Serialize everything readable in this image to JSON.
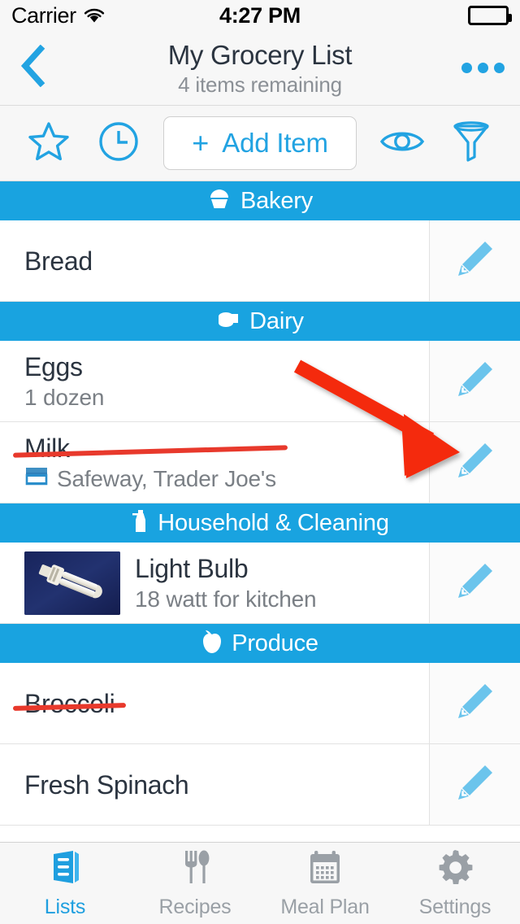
{
  "status_bar": {
    "carrier": "Carrier",
    "wifi_icon": "wifi-icon",
    "time": "4:27 PM",
    "battery_icon": "battery-full-icon"
  },
  "nav_bar": {
    "back_icon": "chevron-left-icon",
    "title": "My Grocery List",
    "subtitle": "4 items remaining",
    "more_icon": "ellipsis-icon"
  },
  "toolbar": {
    "favorite_icon": "star-outline-icon",
    "recent_icon": "clock-icon",
    "add_plus": "+",
    "add_label": "Add Item",
    "view_icon": "eye-icon",
    "filter_icon": "funnel-icon"
  },
  "sections": [
    {
      "title": "Bakery",
      "icon": "cupcake-icon",
      "items": [
        {
          "name": "Bread",
          "detail": "",
          "store": "",
          "completed": false,
          "has_image": false,
          "edit_icon": "pencil-icon"
        }
      ]
    },
    {
      "title": "Dairy",
      "icon": "cheese-icon",
      "items": [
        {
          "name": "Eggs",
          "detail": "1 dozen",
          "store": "",
          "completed": false,
          "has_image": false,
          "edit_icon": "pencil-icon"
        },
        {
          "name": "Milk",
          "detail": "",
          "store": "Safeway, Trader Joe's",
          "completed": true,
          "has_image": false,
          "edit_icon": "pencil-icon"
        }
      ]
    },
    {
      "title": "Household & Cleaning",
      "icon": "spray-bottle-icon",
      "items": [
        {
          "name": "Light Bulb",
          "detail": "18 watt for kitchen",
          "store": "",
          "completed": false,
          "has_image": true,
          "image_alt": "compact-fluorescent-bulb-photo",
          "edit_icon": "pencil-icon"
        }
      ]
    },
    {
      "title": "Produce",
      "icon": "apple-icon",
      "items": [
        {
          "name": "Broccoli",
          "detail": "",
          "store": "",
          "completed": true,
          "has_image": false,
          "edit_icon": "pencil-icon"
        },
        {
          "name": "Fresh Spinach",
          "detail": "",
          "store": "",
          "completed": false,
          "has_image": false,
          "edit_icon": "pencil-icon"
        }
      ]
    }
  ],
  "tab_bar": {
    "tabs": [
      {
        "label": "Lists",
        "icon": "lists-icon",
        "active": true
      },
      {
        "label": "Recipes",
        "icon": "fork-spoon-icon",
        "active": false
      },
      {
        "label": "Meal Plan",
        "icon": "calendar-icon",
        "active": false
      },
      {
        "label": "Settings",
        "icon": "gear-icon",
        "active": false
      }
    ]
  },
  "annotation": {
    "type": "arrow",
    "color": "#f42b10",
    "points_to": "milk-row-edit-button"
  },
  "colors": {
    "accent": "#22a3e2",
    "section_header": "#19a3e0",
    "pencil": "#6bc4ec",
    "text_primary": "#2b3440",
    "text_secondary": "#7a7f85",
    "chrome_bg": "#f7f7f7",
    "annotation_red": "#f42b10"
  }
}
